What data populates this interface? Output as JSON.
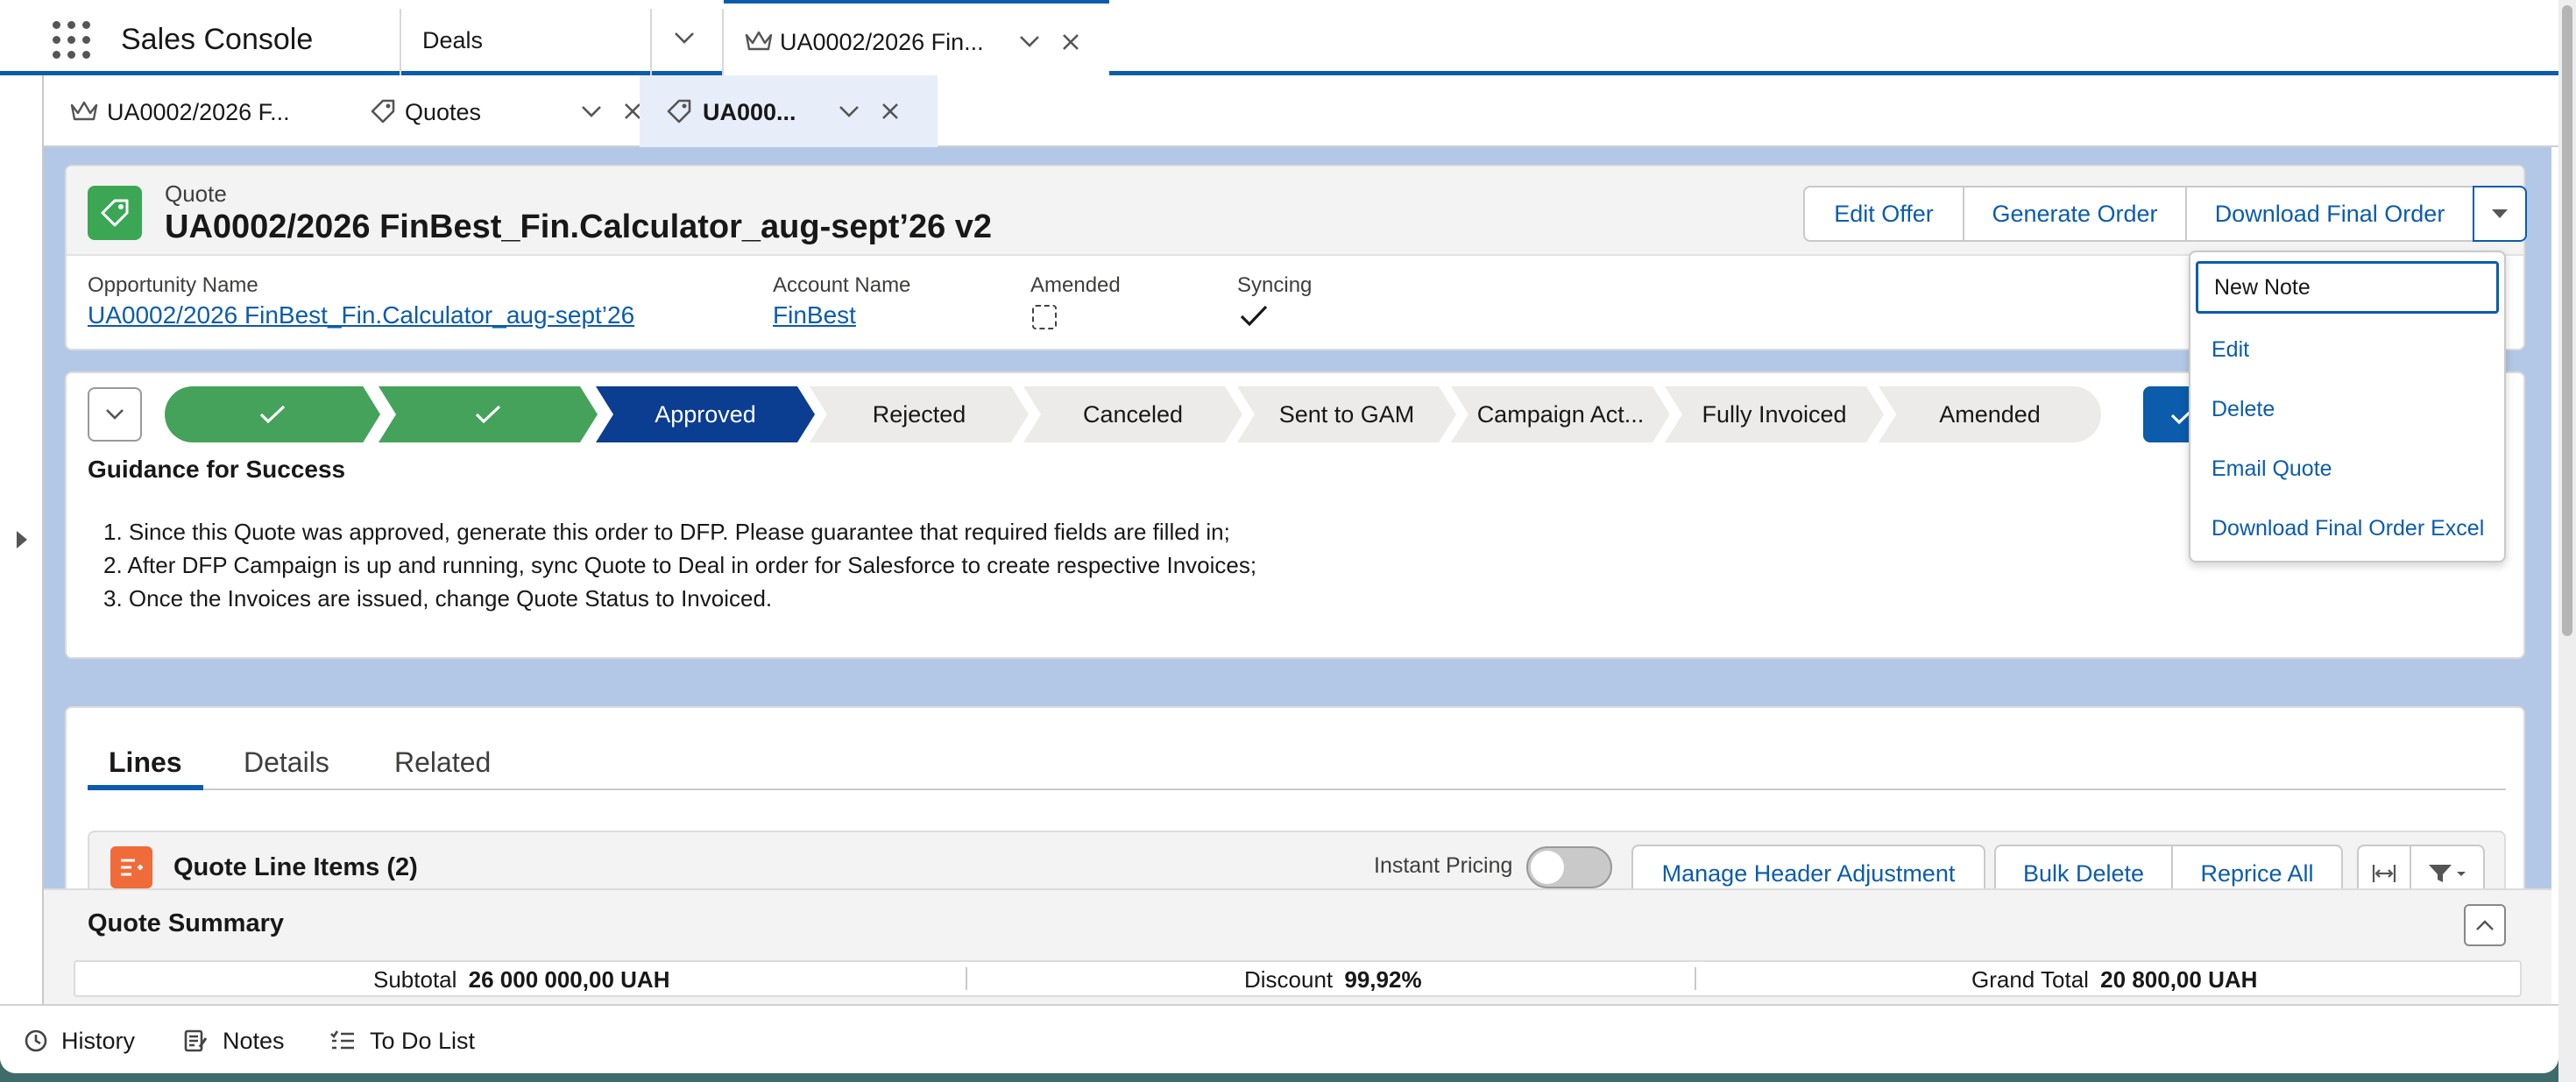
{
  "app": {
    "title": "Sales Console"
  },
  "nav_tabs": [
    {
      "label": "Deals"
    },
    {
      "label": "UA0002/2026 Fin..."
    }
  ],
  "sub_tabs": [
    {
      "label": "UA0002/2026 F..."
    },
    {
      "label": "Quotes"
    },
    {
      "label": "UA000..."
    }
  ],
  "record": {
    "object_label": "Quote",
    "title": "UA0002/2026 FinBest_Fin.Calculator_aug-sept’26 v2",
    "actions": [
      "Edit Offer",
      "Generate Order",
      "Download Final Order"
    ],
    "fields": [
      {
        "label": "Opportunity Name",
        "value": "UA0002/2026 FinBest_Fin.Calculator_aug-sept’26"
      },
      {
        "label": "Account Name",
        "value": "FinBest"
      },
      {
        "label": "Amended",
        "value": "unchecked"
      },
      {
        "label": "Syncing",
        "value": "checked"
      }
    ]
  },
  "dropdown_menu": {
    "items": [
      "New Note",
      "Edit",
      "Delete",
      "Email Quote",
      "Download Final Order Excel"
    ],
    "focused": "New Note"
  },
  "path": {
    "steps": [
      {
        "label": "",
        "state": "complete"
      },
      {
        "label": "",
        "state": "complete"
      },
      {
        "label": "Approved",
        "state": "current"
      },
      {
        "label": "Rejected",
        "state": "incomplete"
      },
      {
        "label": "Canceled",
        "state": "incomplete"
      },
      {
        "label": "Sent to GAM",
        "state": "incomplete"
      },
      {
        "label": "Campaign Act...",
        "state": "incomplete"
      },
      {
        "label": "Fully Invoiced",
        "state": "incomplete"
      },
      {
        "label": "Amended",
        "state": "incomplete"
      }
    ],
    "colors": {
      "complete": "#45a25a",
      "current": "#0b3d91",
      "incomplete": "#ecebea",
      "button": "#0b5cab"
    }
  },
  "guidance": {
    "title": "Guidance for Success",
    "lines": [
      "1. Since this Quote was approved, generate this order to DFP. Please guarantee that required fields are filled in;",
      "2. After DFP Campaign is up and running, sync Quote to Deal in order for Salesforce to create respective Invoices;",
      "3. Once the Invoices are issued, change Quote Status to Invoiced."
    ]
  },
  "detail_tabs": {
    "items": [
      "Lines",
      "Details",
      "Related"
    ],
    "active": "Lines"
  },
  "line_items": {
    "title": "Quote Line Items (2)",
    "instant_pricing_label": "Instant Pricing",
    "instant_pricing_on": false,
    "buttons": [
      "Manage Header Adjustment",
      "Bulk Delete",
      "Reprice All"
    ]
  },
  "summary": {
    "title": "Quote Summary",
    "items": [
      {
        "label": "Subtotal",
        "value": "26 000 000,00 UAH"
      },
      {
        "label": "Discount",
        "value": "99,92%"
      },
      {
        "label": "Grand Total",
        "value": "20 800,00 UAH"
      }
    ]
  },
  "utility_bar": {
    "items": [
      "History",
      "Notes",
      "To Do List"
    ]
  },
  "icons": [
    "app-launcher-icon",
    "chevron-down-icon",
    "close-icon",
    "crown-icon",
    "price-tag-icon",
    "checkmark-icon",
    "collapse-icon",
    "history-icon",
    "notes-icon",
    "todo-list-icon",
    "column-width-icon",
    "filter-icon"
  ]
}
